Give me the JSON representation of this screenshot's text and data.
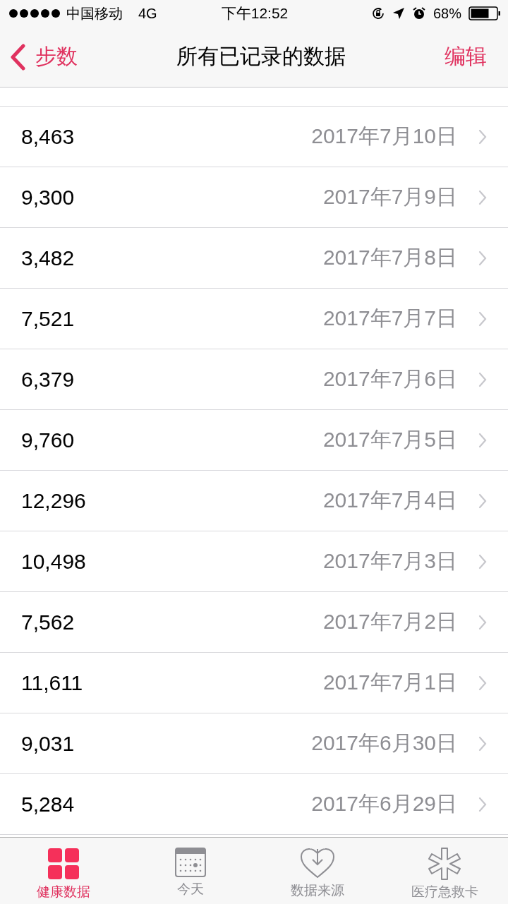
{
  "status_bar": {
    "carrier": "中国移动",
    "network": "4G",
    "time": "下午12:52",
    "battery": "68%"
  },
  "nav": {
    "back": "步数",
    "title": "所有已记录的数据",
    "action": "编辑"
  },
  "rows": [
    {
      "value": "8,463",
      "date": "2017年7月10日"
    },
    {
      "value": "9,300",
      "date": "2017年7月9日"
    },
    {
      "value": "3,482",
      "date": "2017年7月8日"
    },
    {
      "value": "7,521",
      "date": "2017年7月7日"
    },
    {
      "value": "6,379",
      "date": "2017年7月6日"
    },
    {
      "value": "9,760",
      "date": "2017年7月5日"
    },
    {
      "value": "12,296",
      "date": "2017年7月4日"
    },
    {
      "value": "10,498",
      "date": "2017年7月3日"
    },
    {
      "value": "7,562",
      "date": "2017年7月2日"
    },
    {
      "value": "11,611",
      "date": "2017年7月1日"
    },
    {
      "value": "9,031",
      "date": "2017年6月30日"
    },
    {
      "value": "5,284",
      "date": "2017年6月29日"
    }
  ],
  "tabs": [
    {
      "label": "健康数据",
      "selected": true
    },
    {
      "label": "今天",
      "selected": false
    },
    {
      "label": "数据来源",
      "selected": false
    },
    {
      "label": "医疗急救卡",
      "selected": false
    }
  ]
}
